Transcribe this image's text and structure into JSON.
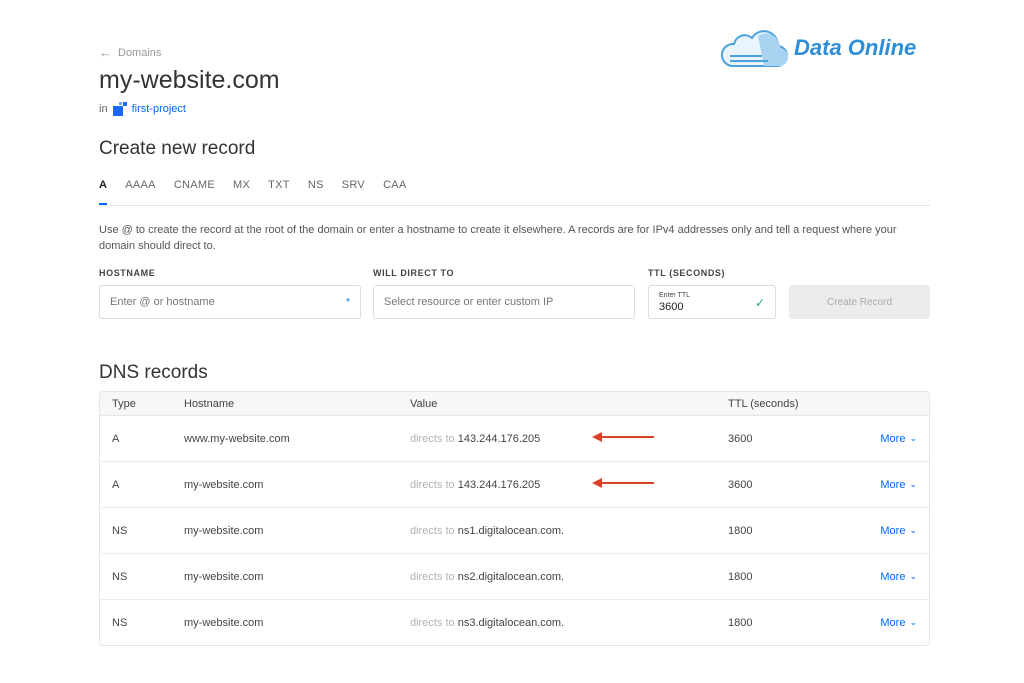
{
  "nav": {
    "back_label": "Domains"
  },
  "domain": {
    "name": "my-website.com",
    "in_label": "in",
    "project": "first-project"
  },
  "logo": {
    "text": "Data Online"
  },
  "create": {
    "title": "Create new record",
    "tabs": [
      "A",
      "AAAA",
      "CNAME",
      "MX",
      "TXT",
      "NS",
      "SRV",
      "CAA"
    ],
    "active_tab": "A",
    "description": "Use @ to create the record at the root of the domain or enter a hostname to create it elsewhere. A records are for IPv4 addresses only and tell a request where your domain should direct to.",
    "hostname_label": "HOSTNAME",
    "hostname_placeholder": "Enter @ or hostname",
    "direct_label": "WILL DIRECT TO",
    "direct_placeholder": "Select resource or enter custom IP",
    "ttl_label": "TTL (SECONDS)",
    "ttl_small_label": "Enter TTL",
    "ttl_value": "3600",
    "button": "Create Record"
  },
  "dns": {
    "title": "DNS records",
    "headers": {
      "type": "Type",
      "hostname": "Hostname",
      "value": "Value",
      "ttl": "TTL (seconds)"
    },
    "directs_prefix": "directs to",
    "more_label": "More",
    "rows": [
      {
        "type": "A",
        "hostname": "www.my-website.com",
        "value": "143.244.176.205",
        "ttl": "3600",
        "arrow": true
      },
      {
        "type": "A",
        "hostname": "my-website.com",
        "value": "143.244.176.205",
        "ttl": "3600",
        "arrow": true
      },
      {
        "type": "NS",
        "hostname": "my-website.com",
        "value": "ns1.digitalocean.com.",
        "ttl": "1800",
        "arrow": false
      },
      {
        "type": "NS",
        "hostname": "my-website.com",
        "value": "ns2.digitalocean.com.",
        "ttl": "1800",
        "arrow": false
      },
      {
        "type": "NS",
        "hostname": "my-website.com",
        "value": "ns3.digitalocean.com.",
        "ttl": "1800",
        "arrow": false
      }
    ]
  },
  "colors": {
    "accent": "#0069ff",
    "arrow": "#d9442b",
    "logo": "#2e8fd6",
    "check": "#22b36b"
  }
}
